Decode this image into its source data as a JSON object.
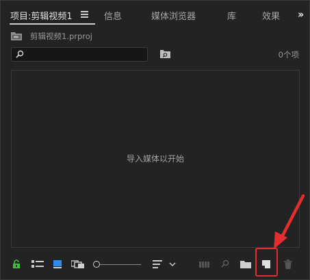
{
  "tabs": [
    {
      "label": "项目:剪辑视频1",
      "active": true
    },
    {
      "label": "信息",
      "active": false
    },
    {
      "label": "媒体浏览器",
      "active": false
    },
    {
      "label": "库",
      "active": false
    },
    {
      "label": "效果",
      "active": false
    }
  ],
  "project": {
    "file_name": "剪辑视频1.prproj"
  },
  "search": {
    "value": "",
    "placeholder": ""
  },
  "item_count": "0个项",
  "content": {
    "empty_message": "导入媒体以开始"
  },
  "toolbar": {
    "icons": [
      "lock-icon",
      "list-view-icon",
      "icon-view-icon",
      "freeform-view-icon",
      "zoom-slider",
      "sort-icon",
      "chevron-down-icon",
      "automate-to-sequence-icon",
      "find-icon",
      "new-bin-icon",
      "new-item-icon",
      "trash-icon"
    ]
  },
  "colors": {
    "background": "#232323",
    "lock_green": "#3fbf3f",
    "icon_view_blue": "#2d8ceb",
    "annotation_red": "#e42d2d"
  }
}
